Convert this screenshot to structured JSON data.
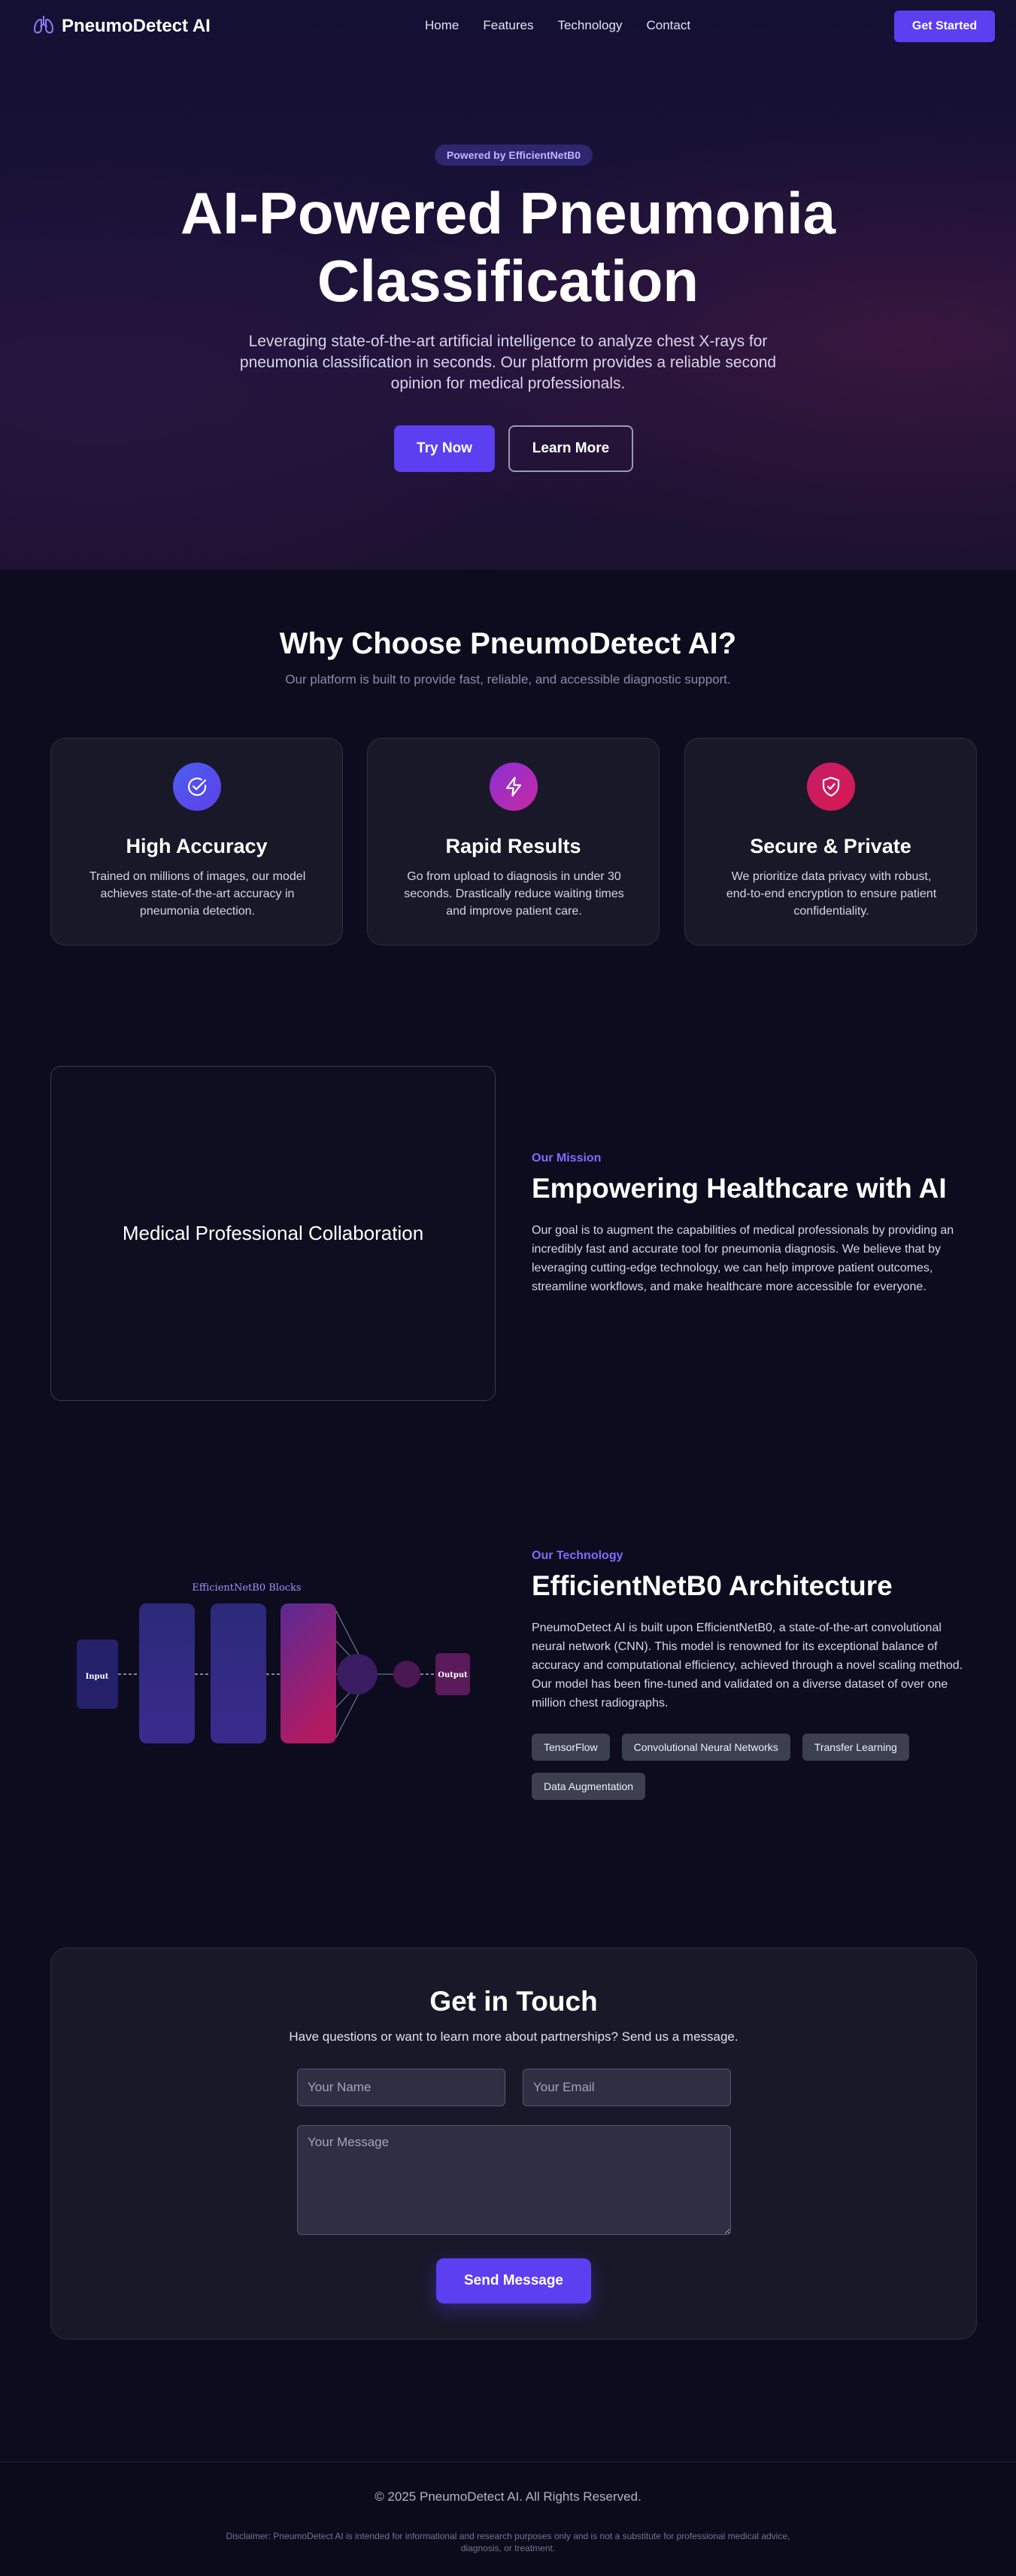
{
  "nav": {
    "brand": "PneumoDetect AI",
    "links": [
      "Home",
      "Features",
      "Technology",
      "Contact"
    ],
    "cta": "Get Started"
  },
  "hero": {
    "badge": "Powered by EfficientNetB0",
    "title_line1": "AI-Powered Pneumonia",
    "title_line2": "Classification",
    "subtitle": "Leveraging state-of-the-art artificial intelligence to analyze chest X-rays for pneumonia classification in seconds. Our platform provides a reliable second opinion for medical professionals.",
    "primary_button": "Try Now",
    "secondary_button": "Learn More"
  },
  "features": {
    "title": "Why Choose PneumoDetect AI?",
    "subtitle": "Our platform is built to provide fast, reliable, and accessible diagnostic support.",
    "cards": [
      {
        "icon": "check-circle-icon",
        "title": "High Accuracy",
        "text": "Trained on millions of images, our model achieves state-of-the-art accuracy in pneumonia detection."
      },
      {
        "icon": "lightning-icon",
        "title": "Rapid Results",
        "text": "Go from upload to diagnosis in under 30 seconds. Drastically reduce waiting times and improve patient care."
      },
      {
        "icon": "shield-icon",
        "title": "Secure & Private",
        "text": "We prioritize data privacy with robust, end-to-end encryption to ensure patient confidentiality."
      }
    ]
  },
  "mission": {
    "image_label": "Medical Professional Collaboration",
    "eyebrow": "Our Mission",
    "title": "Empowering Healthcare with AI",
    "text": "Our goal is to augment the capabilities of medical professionals by providing an incredibly fast and accurate tool for pneumonia diagnosis. We believe that by leveraging cutting-edge technology, we can help improve patient outcomes, streamline workflows, and make healthcare more accessible for everyone."
  },
  "technology": {
    "diagram": {
      "blocks_label": "EfficientNetB0 Blocks",
      "input_label": "Input",
      "output_label": "Output"
    },
    "eyebrow": "Our Technology",
    "title": "EfficientNetB0 Architecture",
    "text": "PneumoDetect AI is built upon EfficientNetB0, a state-of-the-art convolutional neural network (CNN). This model is renowned for its exceptional balance of accuracy and computational efficiency, achieved through a novel scaling method. Our model has been fine-tuned and validated on a diverse dataset of over one million chest radiographs.",
    "tags": [
      "TensorFlow",
      "Convolutional Neural Networks",
      "Transfer Learning",
      "Data Augmentation"
    ]
  },
  "contact": {
    "title": "Get in Touch",
    "subtitle": "Have questions or want to learn more about partnerships? Send us a message.",
    "name_placeholder": "Your Name",
    "email_placeholder": "Your Email",
    "message_placeholder": "Your Message",
    "submit": "Send Message"
  },
  "footer": {
    "copyright": "© 2025 PneumoDetect AI. All Rights Reserved.",
    "disclaimer": "Disclaimer: PneumoDetect AI is intended for informational and research purposes only and is not a substitute for professional medical advice, diagnosis, or treatment."
  },
  "colors": {
    "accent": "#5b3ff0",
    "eyebrow": "#7f6cff",
    "background": "#0d0b1e",
    "card": "#191829"
  }
}
